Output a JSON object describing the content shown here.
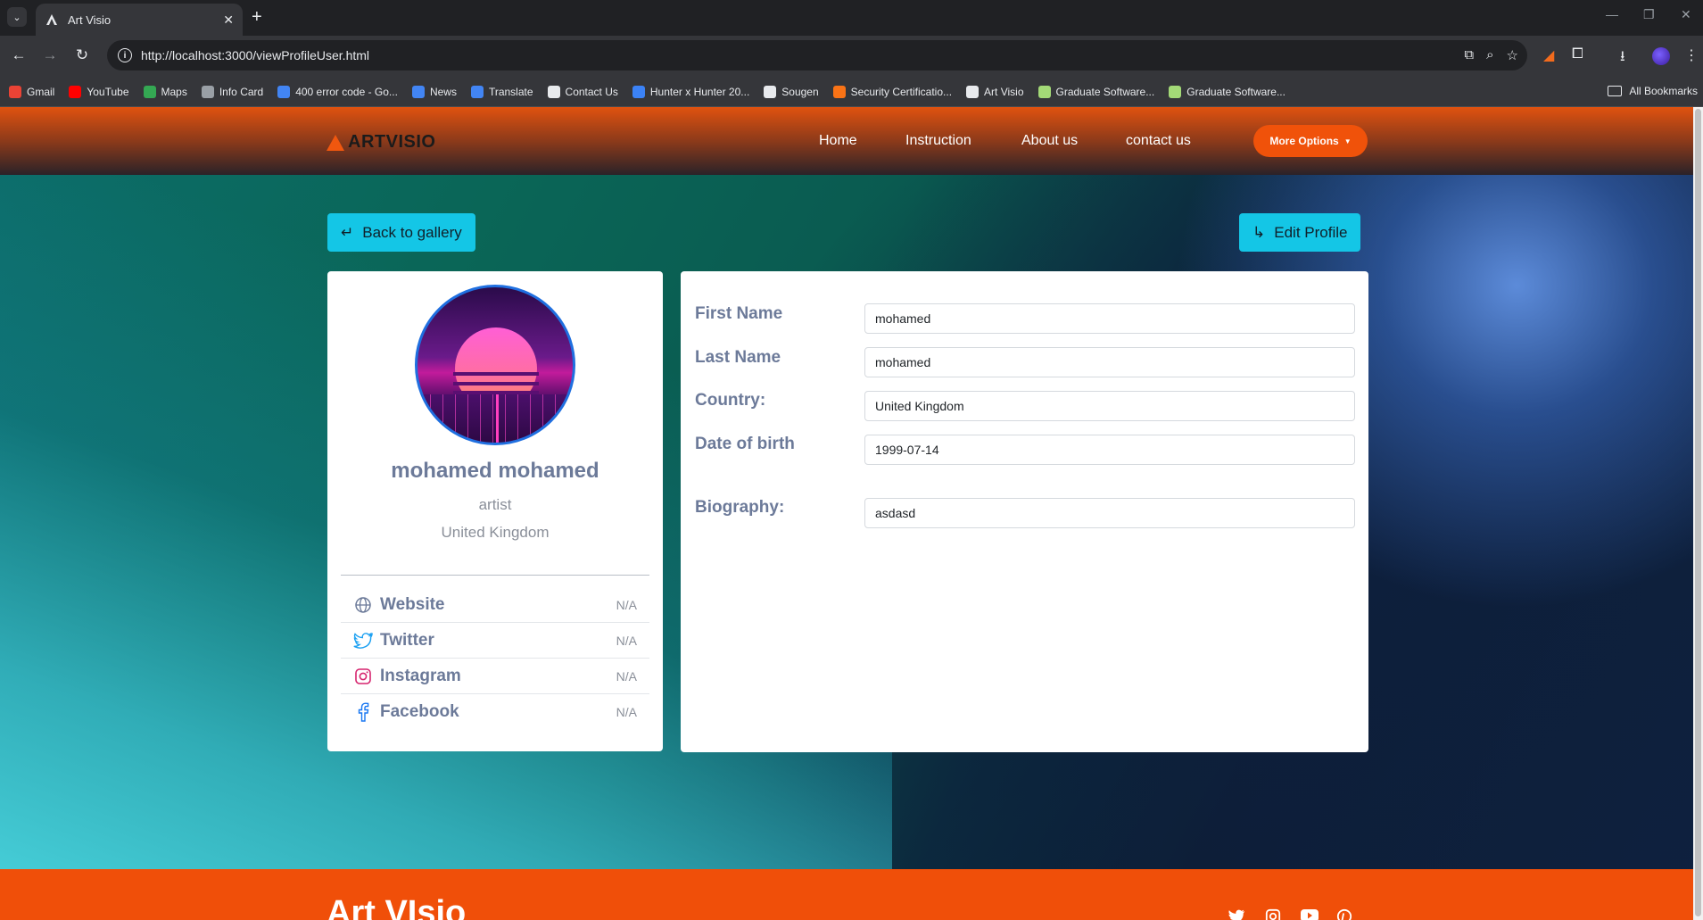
{
  "browser": {
    "tab_title": "Art Visio",
    "url": "http://localhost:3000/viewProfileUser.html",
    "bookmarks": [
      {
        "label": "Gmail",
        "color": "#ea4335"
      },
      {
        "label": "YouTube",
        "color": "#ff0000"
      },
      {
        "label": "Maps",
        "color": "#34a853"
      },
      {
        "label": "Info Card",
        "color": "#9aa0a6"
      },
      {
        "label": "400 error code - Go...",
        "color": "#4285f4"
      },
      {
        "label": "News",
        "color": "#4285f4"
      },
      {
        "label": "Translate",
        "color": "#4285f4"
      },
      {
        "label": "Contact Us",
        "color": "#e8eaed"
      },
      {
        "label": "Hunter x Hunter 20...",
        "color": "#3b82f6"
      },
      {
        "label": "Sougen",
        "color": "#e8eaed"
      },
      {
        "label": "Security Certificatio...",
        "color": "#f97316"
      },
      {
        "label": "Art Visio",
        "color": "#e8eaed"
      },
      {
        "label": "Graduate Software...",
        "color": "#a3d977"
      },
      {
        "label": "Graduate Software...",
        "color": "#a3d977"
      }
    ],
    "all_bookmarks": "All Bookmarks"
  },
  "header": {
    "logo": "ARTVISIO",
    "nav": [
      "Home",
      "Instruction",
      "About us",
      "contact us"
    ],
    "more_options": "More Options"
  },
  "actions": {
    "back": "Back to gallery",
    "edit": "Edit Profile"
  },
  "profile": {
    "name": "mohamed mohamed",
    "role": "artist",
    "country": "United Kingdom",
    "socials": [
      {
        "name": "Website",
        "value": "N/A",
        "icon": "globe-icon"
      },
      {
        "name": "Twitter",
        "value": "N/A",
        "icon": "twitter-icon"
      },
      {
        "name": "Instagram",
        "value": "N/A",
        "icon": "instagram-icon"
      },
      {
        "name": "Facebook",
        "value": "N/A",
        "icon": "facebook-icon"
      }
    ]
  },
  "form": {
    "first_name_label": "First Name",
    "first_name": "mohamed",
    "last_name_label": "Last Name",
    "last_name": "mohamed",
    "country_label": "Country:",
    "country": "United Kingdom",
    "dob_label": "Date of birth",
    "dob": "1999-07-14",
    "bio_label": "Biography:",
    "bio": "asdasd"
  },
  "footer": {
    "brand": "Art VIsio",
    "icons": [
      "twitter-icon",
      "instagram-icon",
      "youtube-icon",
      "pinterest-icon"
    ]
  },
  "colors": {
    "accent": "#f0520a",
    "cyan": "#14c6e6",
    "label": "#6c7a99"
  }
}
